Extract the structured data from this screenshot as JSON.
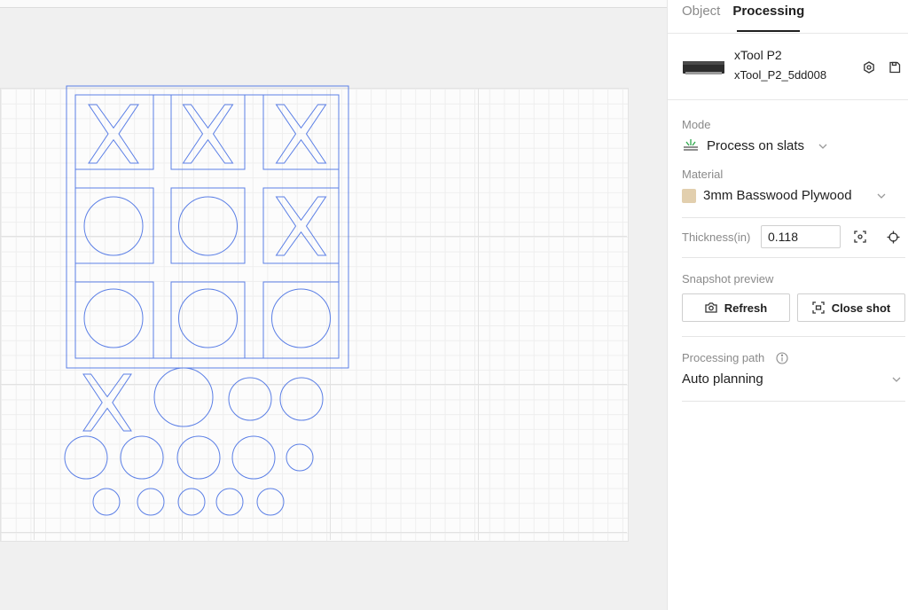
{
  "tabs": [
    {
      "label": "Object",
      "active": false
    },
    {
      "label": "Processing",
      "active": true
    }
  ],
  "device": {
    "name": "xTool P2",
    "id": "xTool_P2_5dd008",
    "icons": [
      "device-settings-icon",
      "save-icon"
    ]
  },
  "mode": {
    "label": "Mode",
    "value": "Process on slats",
    "icon": "slats-icon"
  },
  "material": {
    "label": "Material",
    "value": "3mm Basswood Plywood",
    "swatch_color": "#e2cfae"
  },
  "thickness": {
    "label": "Thickness(in)",
    "value": "0.118",
    "icons": [
      "auto-measure-icon",
      "target-icon"
    ]
  },
  "snapshot": {
    "label": "Snapshot preview",
    "refresh_label": "Refresh",
    "close_shot_label": "Close shot"
  },
  "processing_path": {
    "label": "Processing path",
    "value": "Auto planning"
  },
  "colors": {
    "design_stroke": "#5b7fe6",
    "panel_text": "#1f1f1f",
    "muted_text": "#8a8a8a"
  },
  "canvas": {
    "board_cells": [
      "X",
      "X",
      "X",
      "O",
      "O",
      "X",
      "O",
      "O",
      "O"
    ],
    "loose_pieces": {
      "row1": [
        "X",
        "O",
        "O",
        "O"
      ],
      "row2_circles": 5,
      "row3_circles": 5
    }
  }
}
